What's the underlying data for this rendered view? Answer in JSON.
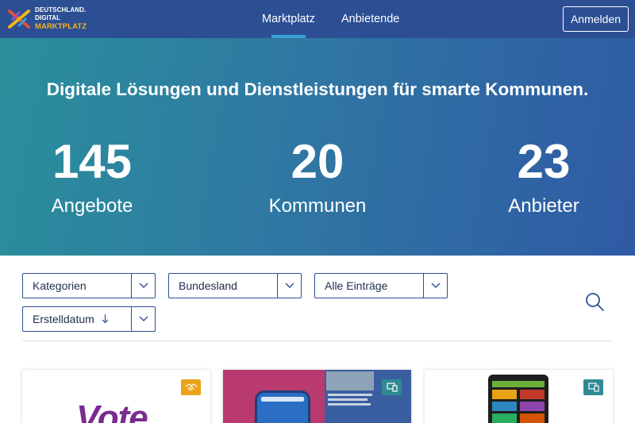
{
  "logo": {
    "line1": "DEUTSCHLAND.",
    "line2": "DIGITAL",
    "line3": "MARKTPLATZ"
  },
  "nav": {
    "items": [
      {
        "label": "Marktplatz",
        "active": true
      },
      {
        "label": "Anbietende",
        "active": false
      }
    ]
  },
  "header": {
    "login_label": "Anmelden"
  },
  "hero": {
    "title": "Digitale Lösungen und Dienstleistungen für smarte Kommunen.",
    "stats": [
      {
        "value": "145",
        "label": "Angebote"
      },
      {
        "value": "20",
        "label": "Kommunen"
      },
      {
        "value": "23",
        "label": "Anbieter"
      }
    ]
  },
  "filters": {
    "category": "Kategorien",
    "state": "Bundesland",
    "entries": "Alle Einträge",
    "sort": "Erstelldatum"
  },
  "cards": [
    {
      "badge_icon": "handshake-icon",
      "badge_color": "#e8a317",
      "image_text": "Vote"
    },
    {
      "badge_icon": "devices-icon",
      "badge_color": "#2f8a93"
    },
    {
      "badge_icon": "devices-icon",
      "badge_color": "#2f8a93"
    }
  ],
  "colors": {
    "nav_bg": "#2c4f94",
    "accent": "#3aa0d8",
    "hero_start": "#2a8f9b",
    "hero_end": "#2f5aa4"
  }
}
